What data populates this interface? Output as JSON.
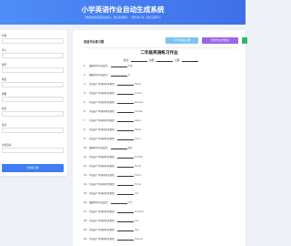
{
  "header": {
    "title": "小学英语作业自动生成系统",
    "subtitle": "轻松生成高质量英语练习，支持多种题型，一键导出打印，助力英语学习"
  },
  "form": {
    "fields": [
      {
        "label": "年级",
        "value": ""
      },
      {
        "label": "单元",
        "value": ""
      },
      {
        "label": "题型",
        "value": ""
      },
      {
        "label": "难度",
        "value": ""
      },
      {
        "label": "题数",
        "value": ""
      },
      {
        "label": "格式",
        "value": ""
      },
      {
        "label": "备注",
        "value": ""
      },
      {
        "label": "生成选项",
        "value": ""
      }
    ],
    "generate_button": "生成练习题"
  },
  "main": {
    "panel_title": "英语作业练习题",
    "print_button": "打印当前练习题",
    "export_button": "导出作业(含答案)",
    "worksheet_title": "二年级英语练习作业",
    "name_label": "姓名：",
    "class_label": "班级：",
    "date_label": "日期：",
    "questions": [
      {
        "num": "1.",
        "prompt": "根据中文写出英文：",
        "word": "苹果"
      },
      {
        "num": "2.",
        "prompt": "根据中文写出英文：",
        "word": "书"
      },
      {
        "num": "3.",
        "prompt": "写出这个单词的中文意思：",
        "word": "father"
      },
      {
        "num": "4.",
        "prompt": "写出这个单词的中文意思：",
        "word": "school"
      },
      {
        "num": "5.",
        "prompt": "写出这个单词的中文意思：",
        "word": "teacher"
      },
      {
        "num": "6.",
        "prompt": "写出这个单词的中文意思：",
        "word": "mother"
      },
      {
        "num": "7.",
        "prompt": "写出这个单词的中文意思：",
        "word": "sister"
      },
      {
        "num": "8.",
        "prompt": "写出这个单词的中文意思：",
        "word": "father"
      },
      {
        "num": "9.",
        "prompt": "写出这个单词的中文意思：",
        "word": "mum"
      },
      {
        "num": "10.",
        "prompt": "根据中文写出英文：",
        "word": "猫咪"
      },
      {
        "num": "11.",
        "prompt": "写出这个单词的中文意思：",
        "word": "brother"
      },
      {
        "num": "12.",
        "prompt": "写出这个单词的中文意思：",
        "word": "family"
      },
      {
        "num": "13.",
        "prompt": "写出这个单词的中文意思：",
        "word": "friend"
      },
      {
        "num": "14.",
        "prompt": "写出这个单词的中文意思：",
        "word": "home"
      },
      {
        "num": "15.",
        "prompt": "写出这个单词的中文意思：",
        "word": "cat"
      },
      {
        "num": "16.",
        "prompt": "根据中文写出英文：",
        "word": "学生"
      },
      {
        "num": "17.",
        "prompt": "写出这个单词的中文意思：",
        "word": "student"
      },
      {
        "num": "18.",
        "prompt": "写出这个单词的中文意思：",
        "word": "pen"
      },
      {
        "num": "19.",
        "prompt": "写出这个单词的中文意思：",
        "word": "dog"
      },
      {
        "num": "20.",
        "prompt": "写出这个单词的中文意思：",
        "word": "flowers"
      }
    ]
  },
  "colors": {
    "header_start": "#4f8df7",
    "header_end": "#3f6fe8",
    "primary_button": "#3f7df3",
    "print_button": "#7ec3f3",
    "export_button": "#9b67e6",
    "green_button": "#35b56a"
  }
}
